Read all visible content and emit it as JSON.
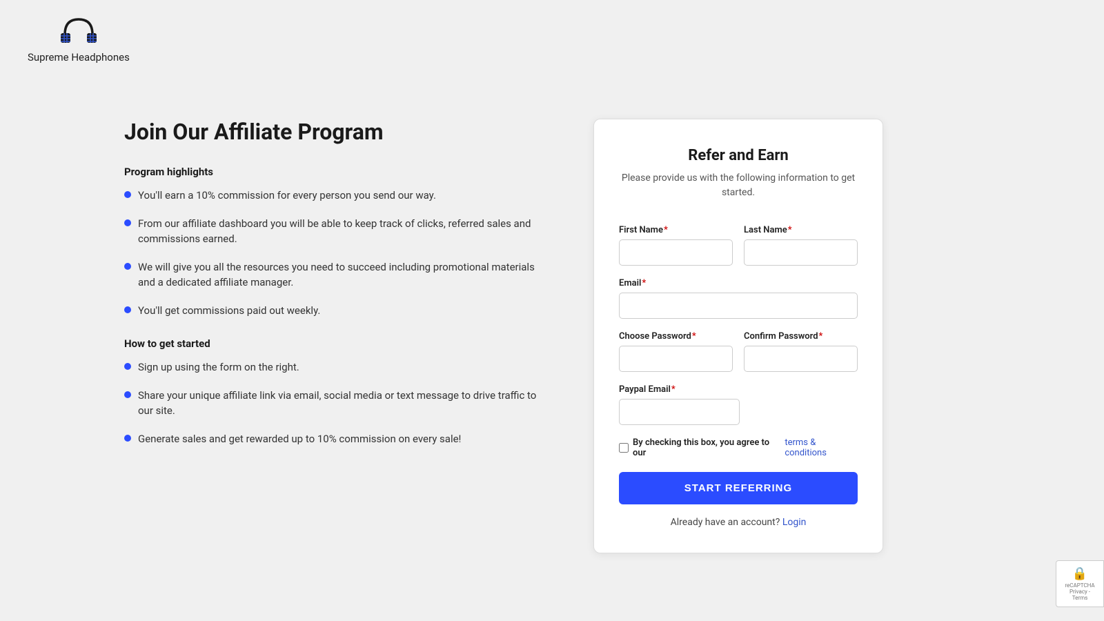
{
  "header": {
    "logo_text": "Supreme Headphones",
    "logo_alt": "Supreme Headphones Logo"
  },
  "left": {
    "page_title": "Join Our Affiliate Program",
    "highlights_heading": "Program highlights",
    "highlights": [
      "You'll earn a 10% commission for every person you send our way.",
      "From our affiliate dashboard you will be able to keep track of clicks, referred sales and commissions earned.",
      "We will give you all the resources you need to succeed including promotional materials and a dedicated affiliate manager.",
      "You'll get commissions paid out weekly."
    ],
    "how_to_heading": "How to get started",
    "how_to": [
      "Sign up using the form on the right.",
      "Share your unique affiliate link via email, social media or text message to drive traffic to our site.",
      "Generate sales and get rewarded up to 10% commission on every sale!"
    ]
  },
  "form": {
    "title": "Refer and Earn",
    "subtitle": "Please provide us with the following information to get started.",
    "first_name_label": "First Name",
    "last_name_label": "Last Name",
    "email_label": "Email",
    "choose_password_label": "Choose Password",
    "confirm_password_label": "Confirm Password",
    "paypal_email_label": "Paypal Email",
    "terms_text": "By checking this box, you agree to our",
    "terms_link_text": "terms & conditions",
    "submit_label": "START REFERRING",
    "already_account_text": "Already have an account?",
    "login_label": "Login"
  },
  "recaptcha": {
    "label": "reCAPTCHA",
    "sub": "Privacy - Terms"
  },
  "colors": {
    "accent": "#2b4cff",
    "required": "#cc0000",
    "link": "#3355cc"
  }
}
